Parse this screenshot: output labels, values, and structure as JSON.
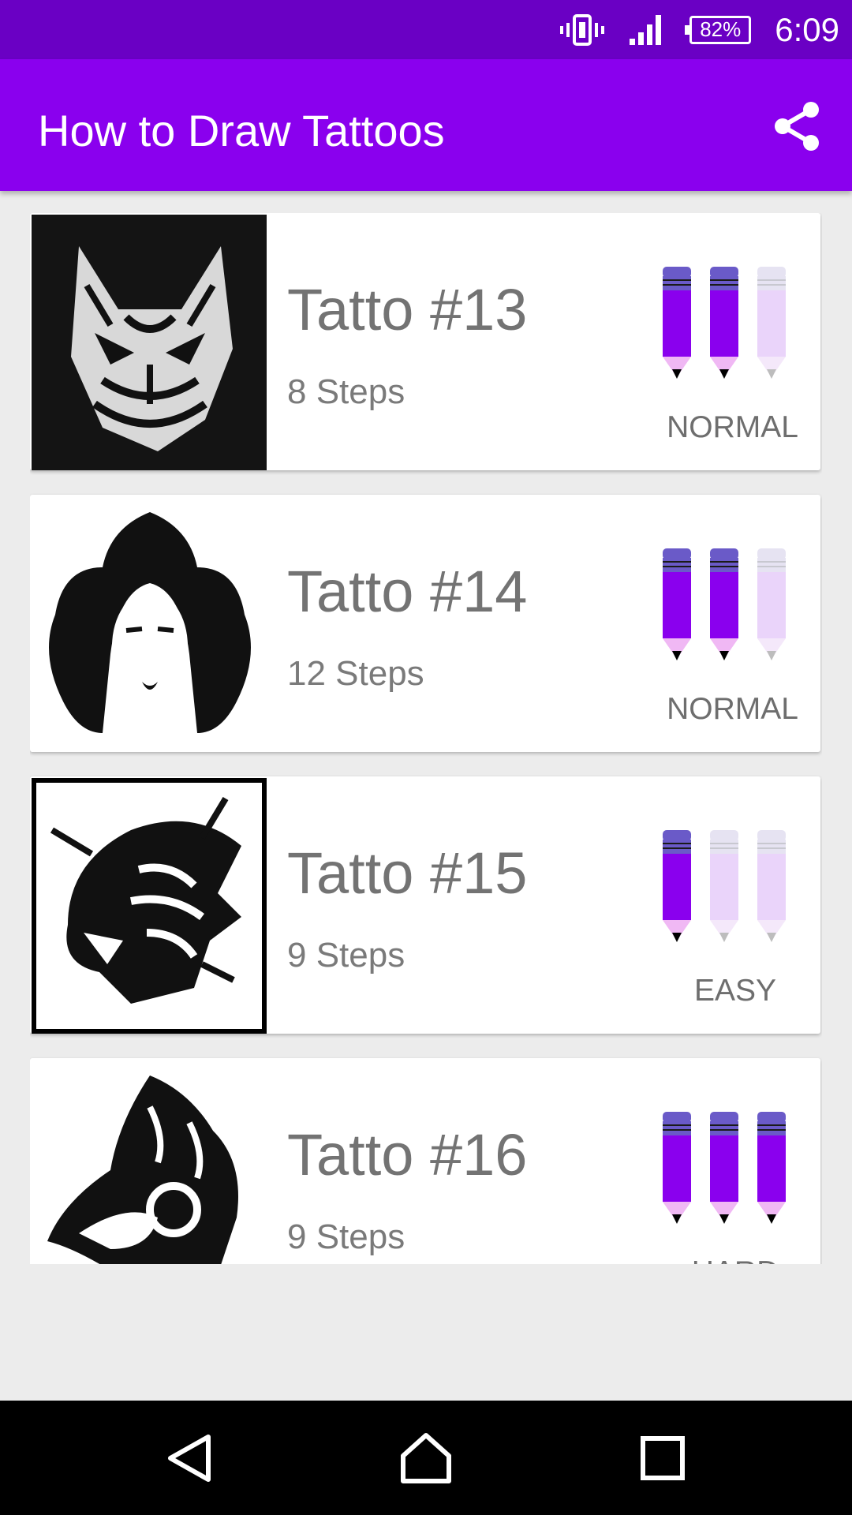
{
  "status_bar": {
    "time": "6:09",
    "battery": "82%",
    "icons": [
      "vibrate-icon",
      "signal-icon",
      "battery-icon"
    ]
  },
  "app_bar": {
    "title": "How to Draw Tattoos",
    "share_icon": "share-icon"
  },
  "colors": {
    "status_bar": "#6a00c4",
    "app_bar": "#8a00ee",
    "pencil_filled": "#8a00ee",
    "pencil_empty": "#ead4fa"
  },
  "tattoos": [
    {
      "title": "Tatto #13",
      "steps": "8 Steps",
      "difficulty": "NORMAL",
      "level": 2,
      "max_level": 3
    },
    {
      "title": "Tatto #14",
      "steps": "12 Steps",
      "difficulty": "NORMAL",
      "level": 2,
      "max_level": 3
    },
    {
      "title": "Tatto #15",
      "steps": "9 Steps",
      "difficulty": "EASY",
      "level": 1,
      "max_level": 3
    },
    {
      "title": "Tatto #16",
      "steps": "9 Steps",
      "difficulty": "HARD",
      "level": 3,
      "max_level": 3
    }
  ],
  "nav_bar": {
    "icons": [
      "back-icon",
      "home-icon",
      "recents-icon"
    ]
  }
}
